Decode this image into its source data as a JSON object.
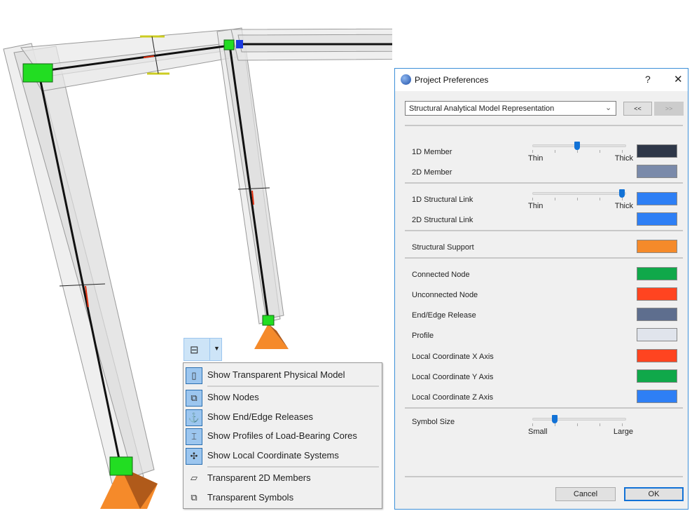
{
  "dialog": {
    "title": "Project Preferences",
    "help": "?",
    "close": "✕",
    "dropdown_value": "Structural Analytical Model Representation",
    "prev_label": "<<",
    "next_label": ">>",
    "slider_member": {
      "min_label": "Thin",
      "max_label": "Thick",
      "value": 0.5
    },
    "slider_link": {
      "min_label": "Thin",
      "max_label": "Thick",
      "value": 1.0
    },
    "slider_symbol": {
      "min_label": "Small",
      "max_label": "Large",
      "value": 0.25
    },
    "rows": [
      {
        "label": "1D Member",
        "color": "#2e3748"
      },
      {
        "label": "2D Member",
        "color": "#7a8aaa"
      },
      {
        "label": "1D Structural Link",
        "color": "#2e7ff5"
      },
      {
        "label": "2D Structural Link",
        "color": "#2e7ff5"
      },
      {
        "label": "Structural Support",
        "color": "#f58a2a"
      },
      {
        "label": "Connected Node",
        "color": "#10a84a"
      },
      {
        "label": "Unconnected Node",
        "color": "#ff4420"
      },
      {
        "label": "End/Edge Release",
        "color": "#5e6e8e"
      },
      {
        "label": "Profile",
        "color": "#e0e4ec"
      },
      {
        "label": "Local Coordinate X Axis",
        "color": "#ff4420"
      },
      {
        "label": "Local Coordinate Y Axis",
        "color": "#10a84a"
      },
      {
        "label": "Local Coordinate Z Axis",
        "color": "#2e7ff5"
      }
    ],
    "symbol_size_label": "Symbol Size",
    "cancel": "Cancel",
    "ok": "OK"
  },
  "menu": {
    "items": [
      {
        "label": "Show Transparent Physical Model",
        "icon": "transparent-model-icon",
        "checked": true
      },
      {
        "label": "Show Nodes",
        "icon": "nodes-icon",
        "checked": true
      },
      {
        "label": "Show End/Edge Releases",
        "icon": "releases-icon",
        "checked": true
      },
      {
        "label": "Show Profiles of Load-Bearing Cores",
        "icon": "profiles-icon",
        "checked": true
      },
      {
        "label": "Show Local Coordinate Systems",
        "icon": "coordinate-systems-icon",
        "checked": true
      },
      {
        "label": "Transparent 2D Members",
        "icon": "2d-members-icon",
        "checked": false
      },
      {
        "label": "Transparent Symbols",
        "icon": "symbols-icon",
        "checked": false
      }
    ]
  }
}
